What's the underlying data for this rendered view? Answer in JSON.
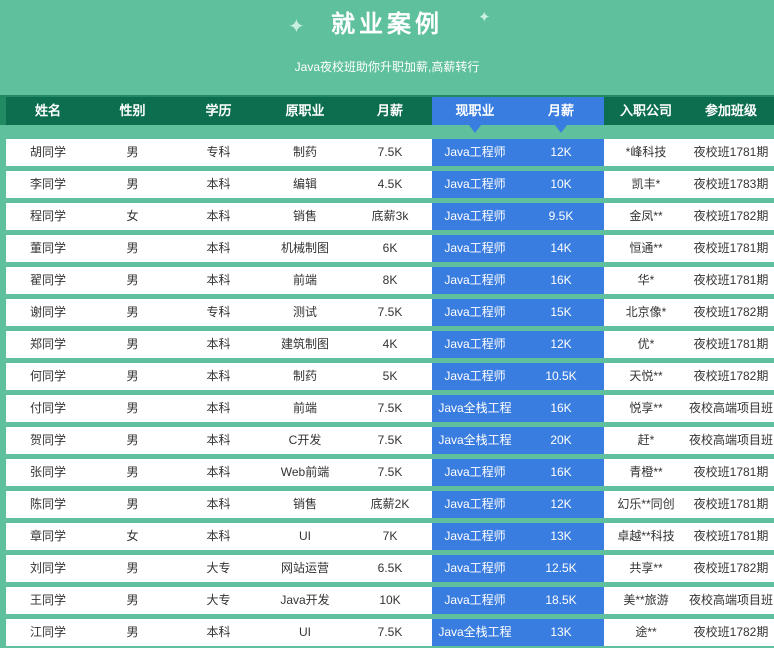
{
  "title": "就业案例",
  "subtitle": "Java夜校班助你升职加薪,高薪转行",
  "colors": {
    "background": "#5ec09c",
    "header": "#0d6e4f",
    "highlight": "#3a7de0"
  },
  "headers": [
    "姓名",
    "性别",
    "学历",
    "原职业",
    "月薪",
    "现职业",
    "月薪",
    "入职公司",
    "参加班级"
  ],
  "rows": [
    [
      "胡同学",
      "男",
      "专科",
      "制药",
      "7.5K",
      "Java工程师",
      "12K",
      "*峰科技",
      "夜校班1781期"
    ],
    [
      "李同学",
      "男",
      "本科",
      "编辑",
      "4.5K",
      "Java工程师",
      "10K",
      "凯丰*",
      "夜校班1783期"
    ],
    [
      "程同学",
      "女",
      "本科",
      "销售",
      "底薪3k",
      "Java工程师",
      "9.5K",
      "金凤**",
      "夜校班1782期"
    ],
    [
      "董同学",
      "男",
      "本科",
      "机械制图",
      "6K",
      "Java工程师",
      "14K",
      "恒通**",
      "夜校班1781期"
    ],
    [
      "翟同学",
      "男",
      "本科",
      "前端",
      "8K",
      "Java工程师",
      "16K",
      "华*",
      "夜校班1781期"
    ],
    [
      "谢同学",
      "男",
      "专科",
      "测试",
      "7.5K",
      "Java工程师",
      "15K",
      "北京像*",
      "夜校班1782期"
    ],
    [
      "郑同学",
      "男",
      "本科",
      "建筑制图",
      "4K",
      "Java工程师",
      "12K",
      "优*",
      "夜校班1781期"
    ],
    [
      "何同学",
      "男",
      "本科",
      "制药",
      "5K",
      "Java工程师",
      "10.5K",
      "天悦**",
      "夜校班1782期"
    ],
    [
      "付同学",
      "男",
      "本科",
      "前端",
      "7.5K",
      "Java全栈工程",
      "16K",
      "悦享**",
      "夜校高端项目班"
    ],
    [
      "贺同学",
      "男",
      "本科",
      "C开发",
      "7.5K",
      "Java全栈工程",
      "20K",
      "赶*",
      "夜校高端项目班"
    ],
    [
      "张同学",
      "男",
      "本科",
      "Web前端",
      "7.5K",
      "Java工程师",
      "16K",
      "青橙**",
      "夜校班1781期"
    ],
    [
      "陈同学",
      "男",
      "本科",
      "销售",
      "底薪2K",
      "Java工程师",
      "12K",
      "幻乐**同创",
      "夜校班1781期"
    ],
    [
      "章同学",
      "女",
      "本科",
      "UI",
      "7K",
      "Java工程师",
      "13K",
      "卓越**科技",
      "夜校班1781期"
    ],
    [
      "刘同学",
      "男",
      "大专",
      "网站运营",
      "6.5K",
      "Java工程师",
      "12.5K",
      "共享**",
      "夜校班1782期"
    ],
    [
      "王同学",
      "男",
      "大专",
      "Java开发",
      "10K",
      "Java工程师",
      "18.5K",
      "美**旅游",
      "夜校高端项目班"
    ],
    [
      "江同学",
      "男",
      "本科",
      "UI",
      "7.5K",
      "Java全栈工程",
      "13K",
      "途**",
      "夜校班1782期"
    ]
  ]
}
